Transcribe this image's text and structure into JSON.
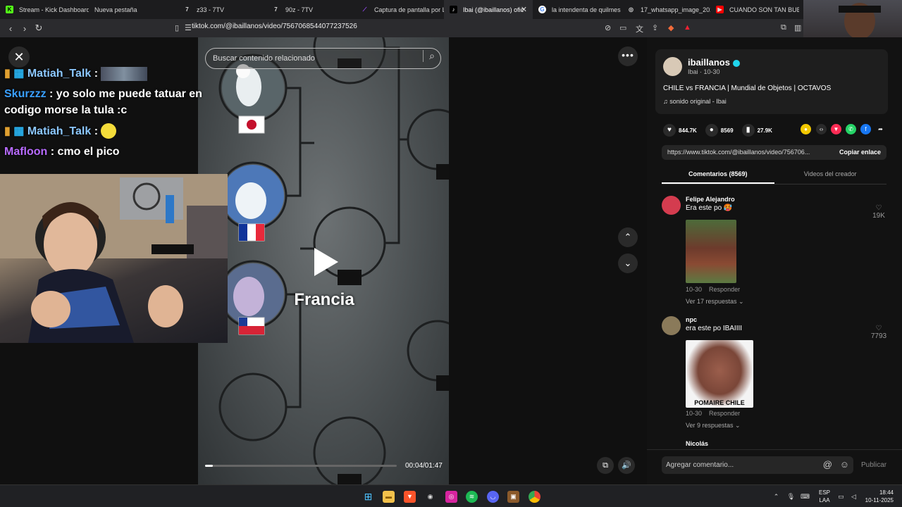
{
  "tabs": [
    {
      "label": "Stream - Kick Dashboard",
      "icon": "kick-icon",
      "color": "#53fc18"
    },
    {
      "label": "Nueva pestaña",
      "icon": "blank-icon",
      "color": "#2b2b2e"
    },
    {
      "label": "z33 - 7TV",
      "icon": "7tv-icon",
      "color": "#2b2b2e"
    },
    {
      "label": "90z - 7TV",
      "icon": "7tv-icon",
      "color": "#2b2b2e"
    },
    {
      "label": "Captura de pantalla por Li",
      "icon": "lightshot-icon",
      "color": "#9c4dff"
    },
    {
      "label": "Ibai (@ibaillanos) ofic",
      "icon": "tiktok-icon",
      "color": "#000000"
    },
    {
      "label": "la intendenta de quilmes",
      "icon": "google-icon",
      "color": "#ffffff"
    },
    {
      "label": "17_whatsapp_image_2022",
      "icon": "globe-icon",
      "color": "#2b2b2e"
    },
    {
      "label": "CUANDO SON TAN BUEN",
      "icon": "youtube-icon",
      "color": "#ff0000"
    }
  ],
  "address": {
    "url": "tiktok.com/@ibaillanos/video/7567068544077237526"
  },
  "chat": [
    {
      "user": "Matiah_Talk",
      "color": "#8cc8ff",
      "text": "",
      "emote": "image-emote"
    },
    {
      "user": "Skurzzz",
      "color": "#3aa0ff",
      "text": "yo solo me puede tatuar en codigo morse la tula :c"
    },
    {
      "user": "Matiah_Talk",
      "color": "#8cc8ff",
      "text": "",
      "emote": "face-emote"
    },
    {
      "user": "Mafloon",
      "color": "#b86bff",
      "text": "cmo el pico"
    }
  ],
  "video": {
    "search_placeholder": "Buscar contenido relacionado",
    "caption": "Francia",
    "time": "00:04/01:47",
    "progress": 0.04
  },
  "sidebar": {
    "username": "ibaillanos",
    "sub": "Ibai · 10-30",
    "description": "CHILE vs FRANCIA | Mundial de Objetos | OCTAVOS",
    "sound": "♫  sonido original - Ibai",
    "likes": "844.7K",
    "comments": "8569",
    "saves": "27.9K",
    "link": "https://www.tiktok.com/@ibaillanos/video/756706...",
    "copy_label": "Copiar enlace",
    "tab_comments": "Comentarios (8569)",
    "tab_videos": "Videos del creador"
  },
  "comments": [
    {
      "name": "Felipe Alejandro",
      "text": "Era este po 🥵",
      "date": "10-30",
      "reply": "Responder",
      "more": "Ver 17 respuestas ⌄",
      "likes": "19K",
      "image_text": ""
    },
    {
      "name": "npc",
      "text": "era este po IBAIIII",
      "date": "10-30",
      "reply": "Responder",
      "more": "Ver 9 respuestas ⌄",
      "likes": "7793",
      "image_text": "POMAIRE CHILE"
    },
    {
      "name": "Nicolás",
      "text": "",
      "date": "",
      "reply": "",
      "more": "",
      "likes": "",
      "image_text": ""
    }
  ],
  "comment_bar": {
    "placeholder": "Agregar comentario...",
    "publish": "Publicar"
  },
  "taskbar": {
    "lang1": "ESP",
    "lang2": "LAA",
    "time": "18:44",
    "date": "10-11-2025"
  }
}
